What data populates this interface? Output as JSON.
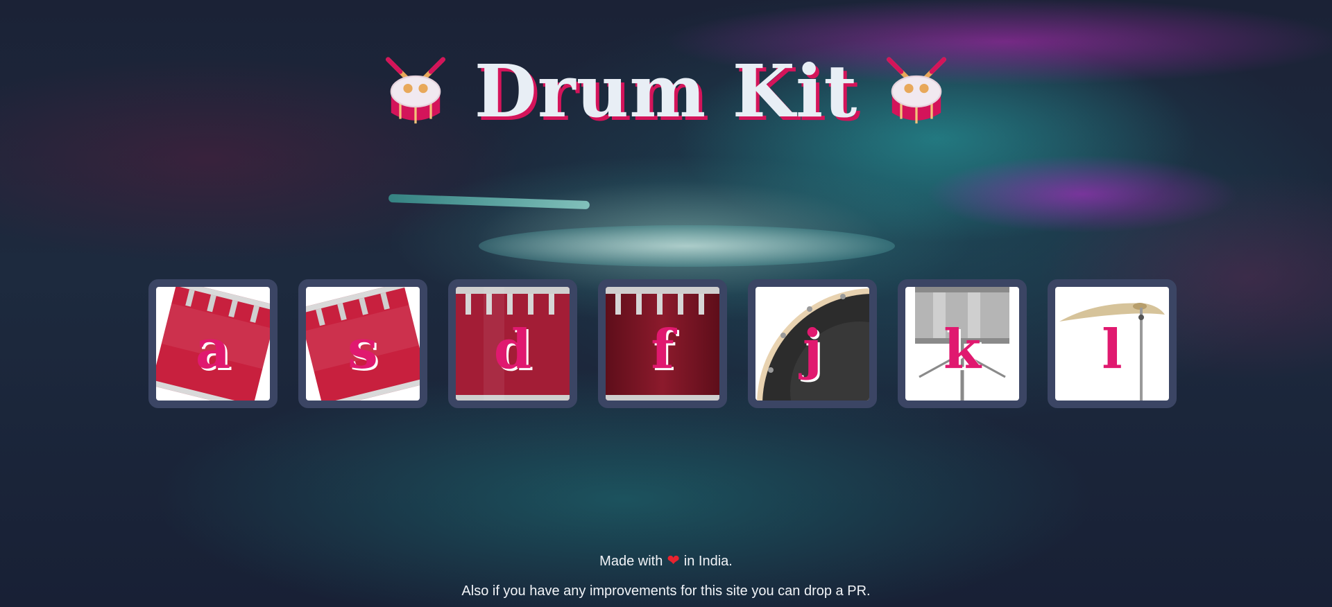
{
  "header": {
    "title": "Drum Kit",
    "left_icon": "drum-icon",
    "right_icon": "drum-icon"
  },
  "keys": [
    {
      "letter": "a",
      "image": "tilted-red-drum",
      "color": "#c8203e"
    },
    {
      "letter": "s",
      "image": "tilted-red-drum",
      "color": "#c8203e"
    },
    {
      "letter": "d",
      "image": "red-snare-drum",
      "color": "#a31d36"
    },
    {
      "letter": "f",
      "image": "dark-red-drum",
      "color": "#7c1424"
    },
    {
      "letter": "j",
      "image": "black-bass-drum",
      "color": "#2c2c2c"
    },
    {
      "letter": "k",
      "image": "silver-drum",
      "color": "#b5b5b5"
    },
    {
      "letter": "l",
      "image": "cymbal",
      "color": "#d6c39a"
    }
  ],
  "footer": {
    "made_with_prefix": "Made with",
    "heart_icon": "heart-icon",
    "made_with_suffix": "in India.",
    "pr_note": "Also if you have any improvements for this site you can drop a PR."
  },
  "colors": {
    "accent": "#e0196f",
    "title_shadow": "#d4145a",
    "key_frame": "#3b4564",
    "background": "#1a2036"
  }
}
